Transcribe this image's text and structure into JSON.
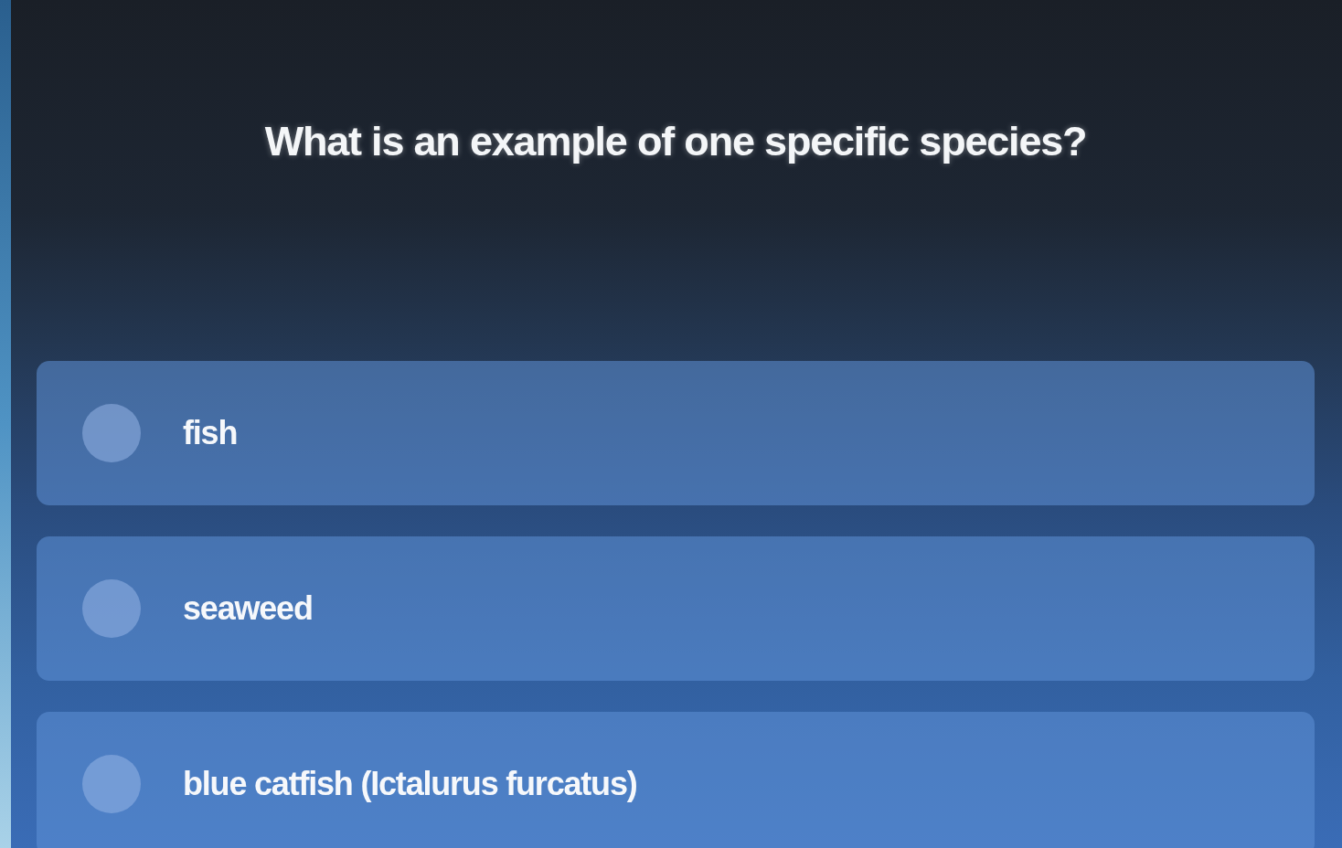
{
  "question": "What is an example of one specific species?",
  "options": [
    {
      "label": "fish",
      "selected": false
    },
    {
      "label": "seaweed",
      "selected": false
    },
    {
      "label": "blue catfish (Ictalurus furcatus)",
      "selected": false
    }
  ]
}
